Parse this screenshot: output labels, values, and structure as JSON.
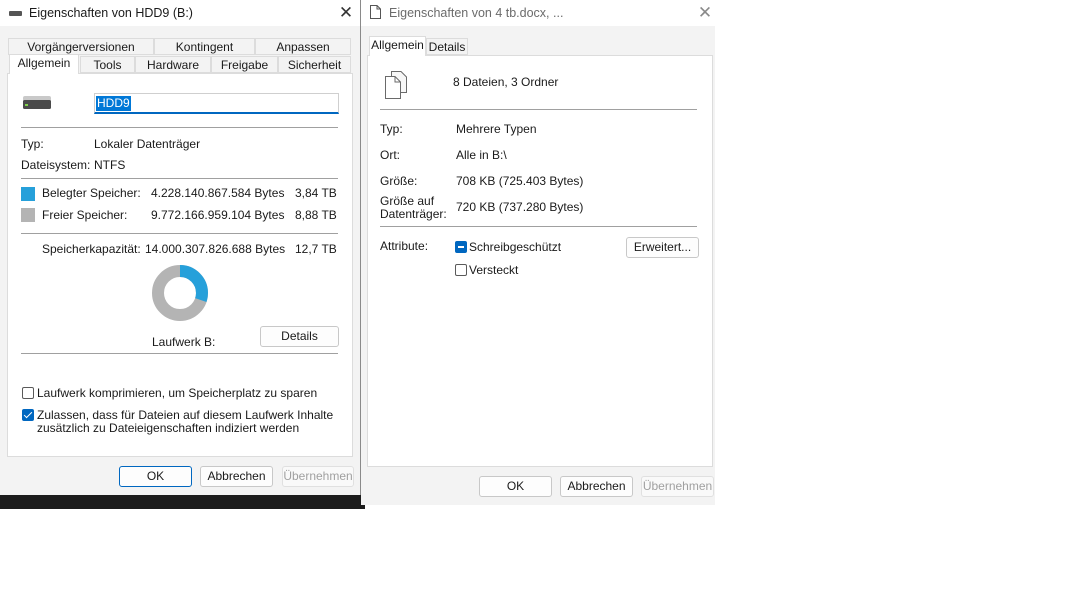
{
  "colors": {
    "used": "#26a0da",
    "free": "#b4b4b4",
    "accent": "#0067c0"
  },
  "drive_dialog": {
    "title": "Eigenschaften von HDD9 (B:)",
    "title_icon": "drive-icon",
    "tabs_top": [
      "Vorgängerversionen",
      "Kontingent",
      "Anpassen"
    ],
    "tabs_bottom": [
      "Allgemein",
      "Tools",
      "Hardware",
      "Freigabe",
      "Sicherheit"
    ],
    "active_tab": "Allgemein",
    "name_value": "HDD9",
    "type_label": "Typ:",
    "type_value": "Lokaler Datenträger",
    "fs_label": "Dateisystem:",
    "fs_value": "NTFS",
    "used_label": "Belegter Speicher:",
    "used_bytes": "4.228.140.867.584 Bytes",
    "used_short": "3,84 TB",
    "free_label": "Freier Speicher:",
    "free_bytes": "9.772.166.959.104 Bytes",
    "free_short": "8,88 TB",
    "cap_label": "Speicherkapazität:",
    "cap_bytes": "14.000.307.826.688 Bytes",
    "cap_short": "12,7 TB",
    "used_fraction": 0.302,
    "drive_label": "Laufwerk B:",
    "details_btn": "Details",
    "compress_label": "Laufwerk komprimieren, um Speicherplatz zu sparen",
    "compress_checked": false,
    "index_label_1": "Zulassen, dass für Dateien auf diesem Laufwerk Inhalte",
    "index_label_2": "zusätzlich zu Dateieigenschaften indiziert werden",
    "index_checked": true,
    "ok": "OK",
    "cancel": "Abbrechen",
    "apply": "Übernehmen"
  },
  "file_dialog": {
    "title": "Eigenschaften von 4 tb.docx, ...",
    "tabs": [
      "Allgemein",
      "Details"
    ],
    "active_tab": "Allgemein",
    "summary": "8 Dateien, 3 Ordner",
    "type_label": "Typ:",
    "type_value": "Mehrere Typen",
    "location_label": "Ort:",
    "location_value": "Alle in B:\\",
    "size_label": "Größe:",
    "size_value": "708 KB (725.403 Bytes)",
    "disk_size_label_1": "Größe auf",
    "disk_size_label_2": "Datenträger:",
    "disk_size_value": "720 KB (737.280 Bytes)",
    "attr_label": "Attribute:",
    "readonly_label": "Schreibgeschützt",
    "readonly_state": "indeterminate",
    "hidden_label": "Versteckt",
    "hidden_checked": false,
    "advanced_btn": "Erweitert...",
    "ok": "OK",
    "cancel": "Abbrechen",
    "apply": "Übernehmen"
  }
}
